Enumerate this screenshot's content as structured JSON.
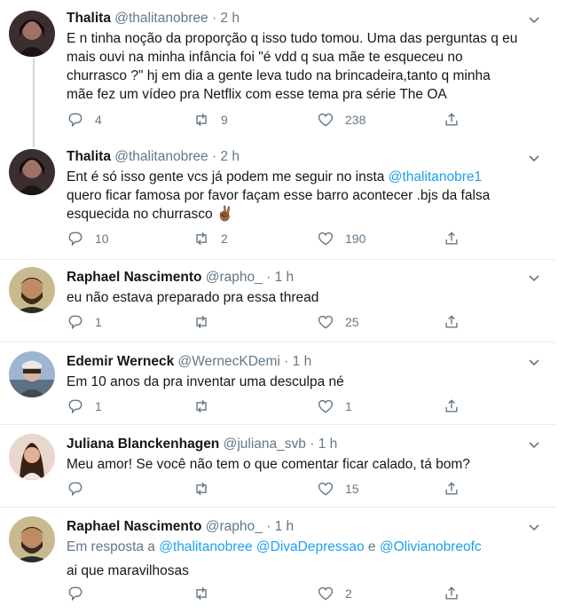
{
  "tweets": [
    {
      "name": "Thalita",
      "handle": "@thalitanobree",
      "dot": "·",
      "time": "2 h",
      "text": "E n tinha noção da proporção q isso tudo tomou. Uma das perguntas  q eu mais ouvi na minha infância foi \"é vdd q sua mãe te esqueceu no churrasco ?\" hj em dia a gente leva tudo na brincadeira,tanto q minha mãe fez um vídeo pra Netflix com esse tema  pra série The OA",
      "replies": "4",
      "retweets": "9",
      "likes": "238",
      "avatar": "thalita-avatar"
    },
    {
      "name": "Thalita",
      "handle": "@thalitanobree",
      "dot": "·",
      "time": "2 h",
      "text_a": "Ent é só isso gente vcs já podem me seguir no insta ",
      "mention": "@thalitanobre1",
      "text_b": " quero ficar famosa por favor façam esse barro acontecer .bjs da falsa esquecida no churrasco ",
      "emoji": "✌🏾",
      "replies": "10",
      "retweets": "2",
      "likes": "190",
      "avatar": "thalita-avatar"
    },
    {
      "name": "Raphael Nascimento",
      "handle": "@rapho_",
      "dot": "·",
      "time": "1 h",
      "text": "eu não estava preparado pra essa thread",
      "replies": "1",
      "retweets": "",
      "likes": "25",
      "avatar": "raphael-avatar"
    },
    {
      "name": "Edemir Werneck",
      "handle": "@WernecKDemi",
      "dot": "·",
      "time": "1 h",
      "text": "Em 10 anos da pra inventar uma desculpa né",
      "replies": "1",
      "retweets": "",
      "likes": "1",
      "avatar": "edemir-avatar"
    },
    {
      "name": "Juliana Blanckenhagen",
      "handle": "@juliana_svb",
      "dot": "·",
      "time": "1 h",
      "text": "Meu amor! Se você não tem o que comentar ficar calado, tá bom?",
      "replies": "",
      "retweets": "",
      "likes": "15",
      "avatar": "juliana-avatar"
    },
    {
      "name": "Raphael Nascimento",
      "handle": "@rapho_",
      "dot": "·",
      "time": "1 h",
      "reply_prefix": "Em resposta a ",
      "reply_m1": "@thalitanobree",
      "reply_m2": "@DivaDepressao",
      "reply_and": " e ",
      "reply_m3": "@Olivianobreofc",
      "text": "ai que maravilhosas",
      "replies": "",
      "retweets": "",
      "likes": "2",
      "avatar": "raphael-avatar"
    }
  ],
  "colors": {
    "text": "#14171a",
    "secondary": "#657786",
    "link": "#1da1f2",
    "divider": "#e6ecf0",
    "thread_line": "#ccd6dd"
  },
  "icons": {
    "reply": "reply-icon",
    "retweet": "retweet-icon",
    "like": "like-icon",
    "share": "share-icon",
    "more": "chevron-down-icon"
  }
}
